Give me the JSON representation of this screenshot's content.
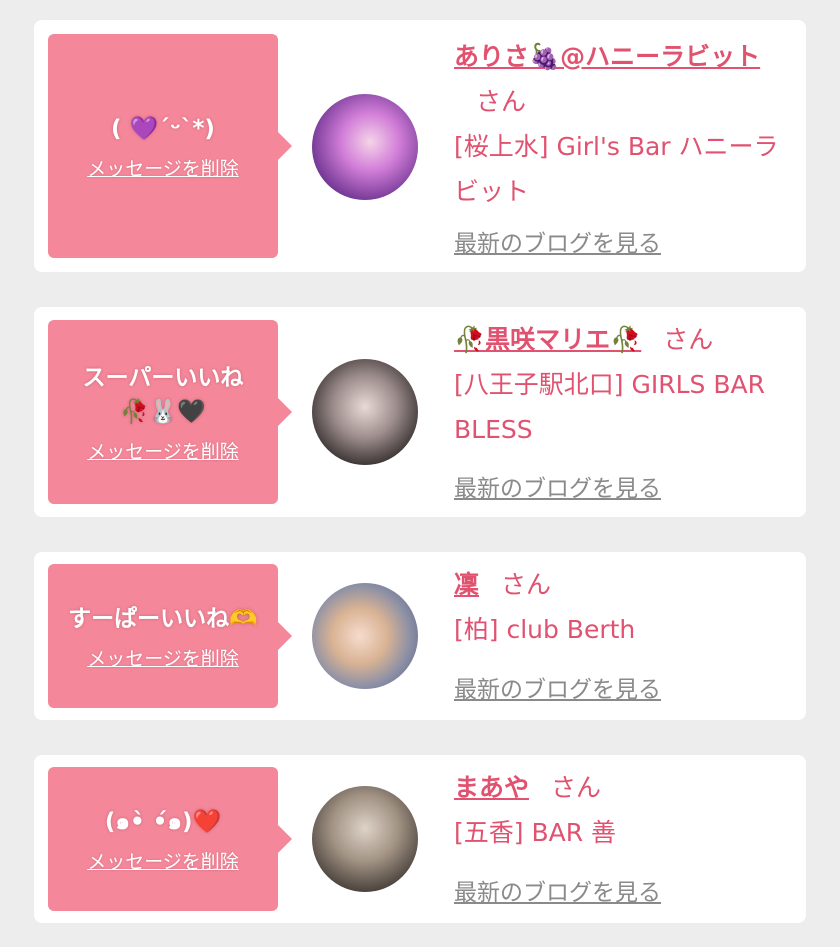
{
  "items": [
    {
      "message": "( 💜ˊᵕˋ*)",
      "message2": "",
      "delete_label": "メッセージを削除",
      "name": "ありさ🍇@ハニーラビット",
      "san": "さん",
      "shop": "[桜上水] Girl's Bar ハニーラビット",
      "blog_label": "最新のブログを見る"
    },
    {
      "message": "スーパーいいね",
      "message2": "🥀🐰🖤",
      "delete_label": "メッセージを削除",
      "name": "🥀黒咲マリエ🥀",
      "san": "さん",
      "shop": "[八王子駅北口] GIRLS BAR BLESS",
      "blog_label": "最新のブログを見る"
    },
    {
      "message": "すーぱーいいね🫶",
      "message2": "",
      "delete_label": "メッセージを削除",
      "name": "凜",
      "san": "さん",
      "shop": "[柏] club Berth",
      "blog_label": "最新のブログを見る"
    },
    {
      "message": "(๑•̀ •́๑)❤️",
      "message2": "",
      "delete_label": "メッセージを削除",
      "name": "まあや",
      "san": "さん",
      "shop": "[五香] BAR 善",
      "blog_label": "最新のブログを見る"
    }
  ]
}
